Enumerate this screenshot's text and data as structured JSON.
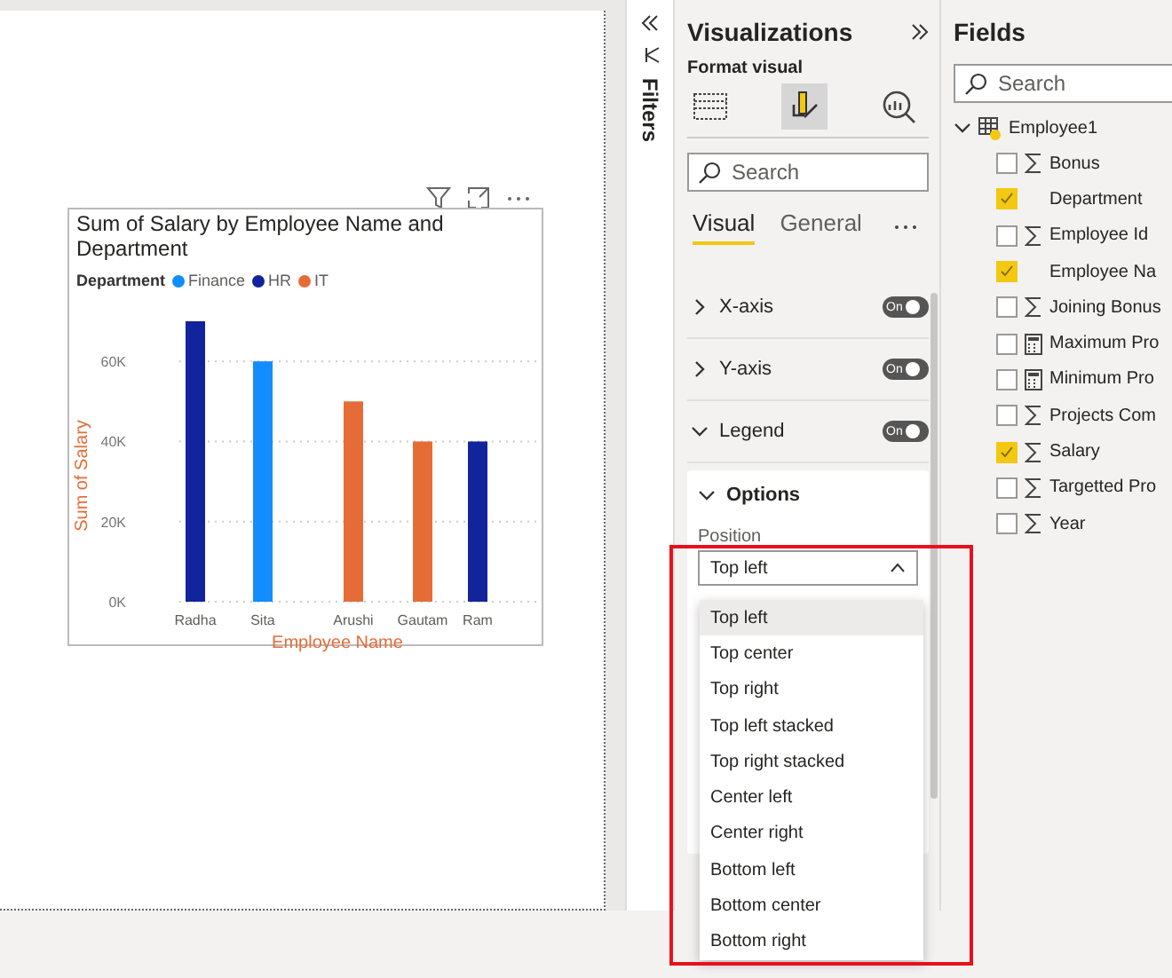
{
  "visual": {
    "title": "Sum of Salary by Employee Name and Department",
    "legend_title": "Department",
    "chart_data": {
      "type": "bar",
      "xlabel": "Employee Name",
      "ylabel": "Sum of Salary",
      "categories": [
        "Radha",
        "Sita",
        "Arushi",
        "Gautam",
        "Ram"
      ],
      "series": [
        {
          "name": "Finance",
          "color": "#118dff",
          "values": [
            null,
            60000,
            null,
            null,
            null
          ]
        },
        {
          "name": "HR",
          "color": "#12239e",
          "values": [
            70000,
            null,
            null,
            null,
            40000
          ]
        },
        {
          "name": "IT",
          "color": "#e66c37",
          "values": [
            null,
            null,
            50000,
            40000,
            null
          ]
        }
      ],
      "ylim": [
        0,
        70000
      ],
      "grid": true,
      "yticks": [
        {
          "value": 0,
          "label": "0K"
        },
        {
          "value": 20000,
          "label": "20K"
        },
        {
          "value": 40000,
          "label": "40K"
        },
        {
          "value": 60000,
          "label": "60K"
        }
      ]
    }
  },
  "filters": {
    "label": "Filters"
  },
  "visualizations": {
    "title": "Visualizations",
    "subtitle": "Format visual",
    "search": {
      "placeholder": "Search"
    },
    "tabs": [
      {
        "label": "Visual",
        "selected": true
      },
      {
        "label": "General",
        "selected": false
      }
    ],
    "sections": [
      {
        "label": "X-axis",
        "expanded": false,
        "on": true,
        "toggle_text": "On"
      },
      {
        "label": "Y-axis",
        "expanded": false,
        "on": true,
        "toggle_text": "On"
      },
      {
        "label": "Legend",
        "expanded": true,
        "on": true,
        "toggle_text": "On"
      }
    ],
    "options": {
      "label": "Options",
      "expanded": true,
      "field_label": "Position",
      "value": "Top left"
    },
    "dropdown": [
      {
        "label": "Top left",
        "selected": true
      },
      {
        "label": "Top center",
        "selected": false
      },
      {
        "label": "Top right",
        "selected": false
      },
      {
        "label": "Top left stacked",
        "selected": false
      },
      {
        "label": "Top right stacked",
        "selected": false
      },
      {
        "label": "Center left",
        "selected": false
      },
      {
        "label": "Center right",
        "selected": false
      },
      {
        "label": "Bottom left",
        "selected": false
      },
      {
        "label": "Bottom center",
        "selected": false
      },
      {
        "label": "Bottom right",
        "selected": false
      }
    ]
  },
  "fields": {
    "title": "Fields",
    "search": {
      "placeholder": "Search"
    },
    "table": {
      "name": "Employee1",
      "expanded": true,
      "children": [
        {
          "name": "Bonus",
          "kind": "sum",
          "checked": false
        },
        {
          "name": "Department",
          "kind": "text",
          "checked": true
        },
        {
          "name": "Employee Id",
          "kind": "sum",
          "checked": false
        },
        {
          "name": "Employee Na",
          "kind": "text",
          "checked": true
        },
        {
          "name": "Joining Bonus",
          "kind": "sum",
          "checked": false
        },
        {
          "name": "Maximum Pro",
          "kind": "measure",
          "checked": false
        },
        {
          "name": "Minimum Pro",
          "kind": "measure",
          "checked": false
        },
        {
          "name": "Projects Com",
          "kind": "sum",
          "checked": false
        },
        {
          "name": "Salary",
          "kind": "sum",
          "checked": true
        },
        {
          "name": "Targetted Pro",
          "kind": "sum",
          "checked": false
        },
        {
          "name": "Year",
          "kind": "sum",
          "checked": false
        }
      ]
    }
  }
}
